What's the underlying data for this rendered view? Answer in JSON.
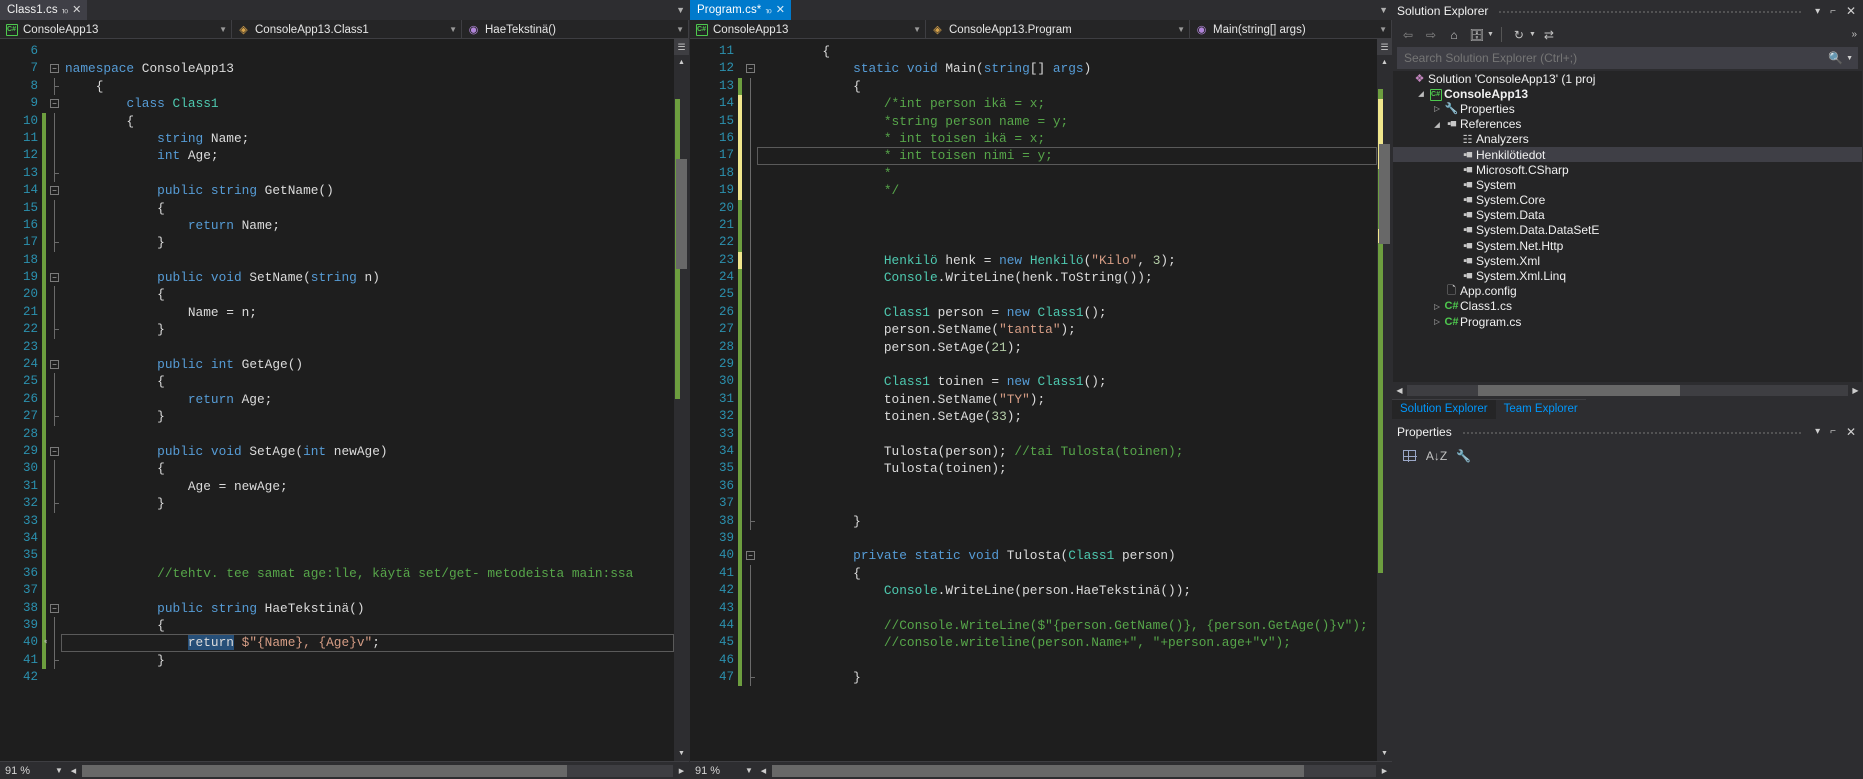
{
  "left_pane": {
    "tab": {
      "title": "Class1.cs",
      "pin": "⌐",
      "close": "✕",
      "state": "active-unfocused"
    },
    "navbar": {
      "project": "ConsoleApp13",
      "type": "ConsoleApp13.Class1",
      "member": "HaeTekstinä()",
      "project_icon": "csharp-project-icon",
      "type_icon": "class-icon",
      "member_icon": "method-icon"
    },
    "zoom_level": "91 %",
    "first_line": 6,
    "lines": [
      {
        "n": 6,
        "text": ""
      },
      {
        "n": 7,
        "text": "namespace ConsoleApp13"
      },
      {
        "n": 8,
        "text": "    {"
      },
      {
        "n": 9,
        "text": "        class Class1"
      },
      {
        "n": 10,
        "text": "        {"
      },
      {
        "n": 11,
        "text": "            string Name;"
      },
      {
        "n": 12,
        "text": "            int Age;"
      },
      {
        "n": 13,
        "text": ""
      },
      {
        "n": 14,
        "text": "            public string GetName()"
      },
      {
        "n": 15,
        "text": "            {"
      },
      {
        "n": 16,
        "text": "                return Name;"
      },
      {
        "n": 17,
        "text": "            }"
      },
      {
        "n": 18,
        "text": ""
      },
      {
        "n": 19,
        "text": "            public void SetName(string n)"
      },
      {
        "n": 20,
        "text": "            {"
      },
      {
        "n": 21,
        "text": "                Name = n;"
      },
      {
        "n": 22,
        "text": "            }"
      },
      {
        "n": 23,
        "text": ""
      },
      {
        "n": 24,
        "text": "            public int GetAge()"
      },
      {
        "n": 25,
        "text": "            {"
      },
      {
        "n": 26,
        "text": "                return Age;"
      },
      {
        "n": 27,
        "text": "            }"
      },
      {
        "n": 28,
        "text": ""
      },
      {
        "n": 29,
        "text": "            public void SetAge(int newAge)"
      },
      {
        "n": 30,
        "text": "            {"
      },
      {
        "n": 31,
        "text": "                Age = newAge;"
      },
      {
        "n": 32,
        "text": "            }"
      },
      {
        "n": 33,
        "text": ""
      },
      {
        "n": 34,
        "text": ""
      },
      {
        "n": 35,
        "text": ""
      },
      {
        "n": 36,
        "text": "            //tehtv. tee samat age:lle, käytä set/get- metodeista main:ssa"
      },
      {
        "n": 37,
        "text": ""
      },
      {
        "n": 38,
        "text": "            public string HaeTekstinä()"
      },
      {
        "n": 39,
        "text": "            {"
      },
      {
        "n": 40,
        "text": "                return $\"{Name}, {Age}v\";"
      },
      {
        "n": 41,
        "text": "            }"
      },
      {
        "n": 42,
        "text": ""
      }
    ]
  },
  "right_pane": {
    "tab": {
      "title": "Program.cs*",
      "pin": "⌐",
      "close": "✕",
      "state": "active-focused"
    },
    "navbar": {
      "project": "ConsoleApp13",
      "type": "ConsoleApp13.Program",
      "member": "Main(string[] args)",
      "project_icon": "csharp-project-icon",
      "type_icon": "class-icon",
      "member_icon": "method-private-icon"
    },
    "zoom_level": "91 %",
    "first_line": 11,
    "lines": [
      {
        "n": 11,
        "text": "        {"
      },
      {
        "n": 12,
        "text": "            static void Main(string[] args)"
      },
      {
        "n": 13,
        "text": "            {"
      },
      {
        "n": 14,
        "text": "                /*int person ikä = x;"
      },
      {
        "n": 15,
        "text": "                *string person name = y;"
      },
      {
        "n": 16,
        "text": "                * int toisen ikä = x;"
      },
      {
        "n": 17,
        "text": "                * int toisen nimi = y;"
      },
      {
        "n": 18,
        "text": "                *"
      },
      {
        "n": 19,
        "text": "                */"
      },
      {
        "n": 20,
        "text": ""
      },
      {
        "n": 21,
        "text": ""
      },
      {
        "n": 22,
        "text": ""
      },
      {
        "n": 23,
        "text": "                Henkilö henk = new Henkilö(\"Kilo\", 3);"
      },
      {
        "n": 24,
        "text": "                Console.WriteLine(henk.ToString());"
      },
      {
        "n": 25,
        "text": ""
      },
      {
        "n": 26,
        "text": "                Class1 person = new Class1();"
      },
      {
        "n": 27,
        "text": "                person.SetName(\"tantta\");"
      },
      {
        "n": 28,
        "text": "                person.SetAge(21);"
      },
      {
        "n": 29,
        "text": ""
      },
      {
        "n": 30,
        "text": "                Class1 toinen = new Class1();"
      },
      {
        "n": 31,
        "text": "                toinen.SetName(\"TY\");"
      },
      {
        "n": 32,
        "text": "                toinen.SetAge(33);"
      },
      {
        "n": 33,
        "text": ""
      },
      {
        "n": 34,
        "text": "                Tulosta(person); //tai Tulosta(toinen);"
      },
      {
        "n": 35,
        "text": "                Tulosta(toinen);"
      },
      {
        "n": 36,
        "text": ""
      },
      {
        "n": 37,
        "text": ""
      },
      {
        "n": 38,
        "text": "            }"
      },
      {
        "n": 39,
        "text": ""
      },
      {
        "n": 40,
        "text": "            private static void Tulosta(Class1 person)"
      },
      {
        "n": 41,
        "text": "            {"
      },
      {
        "n": 42,
        "text": "                Console.WriteLine(person.HaeTekstinä());"
      },
      {
        "n": 43,
        "text": ""
      },
      {
        "n": 44,
        "text": "                //Console.WriteLine($\"{person.GetName()}, {person.GetAge()}v\");"
      },
      {
        "n": 45,
        "text": "                //console.writeline(person.Name+\", \"+person.age+\"v\");"
      },
      {
        "n": 46,
        "text": ""
      },
      {
        "n": 47,
        "text": "            }"
      }
    ]
  },
  "solution_explorer": {
    "title": "Solution Explorer",
    "header_buttons": {
      "dropdown": "▾",
      "pin": "⌐",
      "close": "✕"
    },
    "toolbar": {
      "back": "back-icon",
      "forward": "forward-icon",
      "home": "home-icon",
      "pending_changes": "pending-changes-icon",
      "show_all": "show-all-files-icon",
      "refresh": "refresh-icon",
      "collapse": "collapse-icon",
      "overflow": "»"
    },
    "search_placeholder": "Search Solution Explorer (Ctrl+;)",
    "search_value": "",
    "tree": [
      {
        "label": "Solution 'ConsoleApp13' (1 proj",
        "depth": 0,
        "expander": "",
        "icon": "solution-icon",
        "bold": false,
        "selected": false
      },
      {
        "label": "ConsoleApp13",
        "depth": 1,
        "expander": "◢",
        "icon": "csharp-project-icon",
        "bold": true,
        "selected": false
      },
      {
        "label": "Properties",
        "depth": 2,
        "expander": "▷",
        "icon": "wrench-icon",
        "bold": false,
        "selected": false
      },
      {
        "label": "References",
        "depth": 2,
        "expander": "◢",
        "icon": "references-icon",
        "bold": false,
        "selected": false
      },
      {
        "label": "Analyzers",
        "depth": 3,
        "expander": "",
        "icon": "analyzers-icon",
        "bold": false,
        "selected": false
      },
      {
        "label": "Henkilötiedot",
        "depth": 3,
        "expander": "",
        "icon": "reference-icon",
        "bold": false,
        "selected": true
      },
      {
        "label": "Microsoft.CSharp",
        "depth": 3,
        "expander": "",
        "icon": "reference-icon",
        "bold": false,
        "selected": false
      },
      {
        "label": "System",
        "depth": 3,
        "expander": "",
        "icon": "reference-icon",
        "bold": false,
        "selected": false
      },
      {
        "label": "System.Core",
        "depth": 3,
        "expander": "",
        "icon": "reference-icon",
        "bold": false,
        "selected": false
      },
      {
        "label": "System.Data",
        "depth": 3,
        "expander": "",
        "icon": "reference-icon",
        "bold": false,
        "selected": false
      },
      {
        "label": "System.Data.DataSetE",
        "depth": 3,
        "expander": "",
        "icon": "reference-icon",
        "bold": false,
        "selected": false
      },
      {
        "label": "System.Net.Http",
        "depth": 3,
        "expander": "",
        "icon": "reference-icon",
        "bold": false,
        "selected": false
      },
      {
        "label": "System.Xml",
        "depth": 3,
        "expander": "",
        "icon": "reference-icon",
        "bold": false,
        "selected": false
      },
      {
        "label": "System.Xml.Linq",
        "depth": 3,
        "expander": "",
        "icon": "reference-icon",
        "bold": false,
        "selected": false
      },
      {
        "label": "App.config",
        "depth": 2,
        "expander": "",
        "icon": "config-icon",
        "bold": false,
        "selected": false
      },
      {
        "label": "Class1.cs",
        "depth": 2,
        "expander": "▷",
        "icon": "csharp-file-icon",
        "bold": false,
        "selected": false
      },
      {
        "label": "Program.cs",
        "depth": 2,
        "expander": "▷",
        "icon": "csharp-file-icon",
        "bold": false,
        "selected": false
      }
    ],
    "dock_tabs": [
      {
        "label": "Solution Explorer",
        "active": true
      },
      {
        "label": "Team Explorer",
        "active": false
      }
    ]
  },
  "properties_panel": {
    "title": "Properties",
    "header_buttons": {
      "dropdown": "▾",
      "pin": "⌐",
      "close": "✕"
    },
    "toolbar": {
      "categorized": "categorized-icon",
      "alphabetical": "alphabetical-sort-icon",
      "properties": "properties-icon"
    }
  },
  "colors": {
    "accent": "#007acc",
    "editor_bg": "#1e1e1e",
    "chrome_bg": "#2d2d30",
    "panel_bg": "#252526",
    "line_number": "#2b91af",
    "keyword": "#569cd6",
    "type": "#4ec9b0",
    "string": "#d69d85",
    "comment": "#57a64a",
    "number": "#b5cea8",
    "selection": "#264f78",
    "change_saved": "#6d9e3f",
    "change_unsaved": "#f0e68c"
  }
}
